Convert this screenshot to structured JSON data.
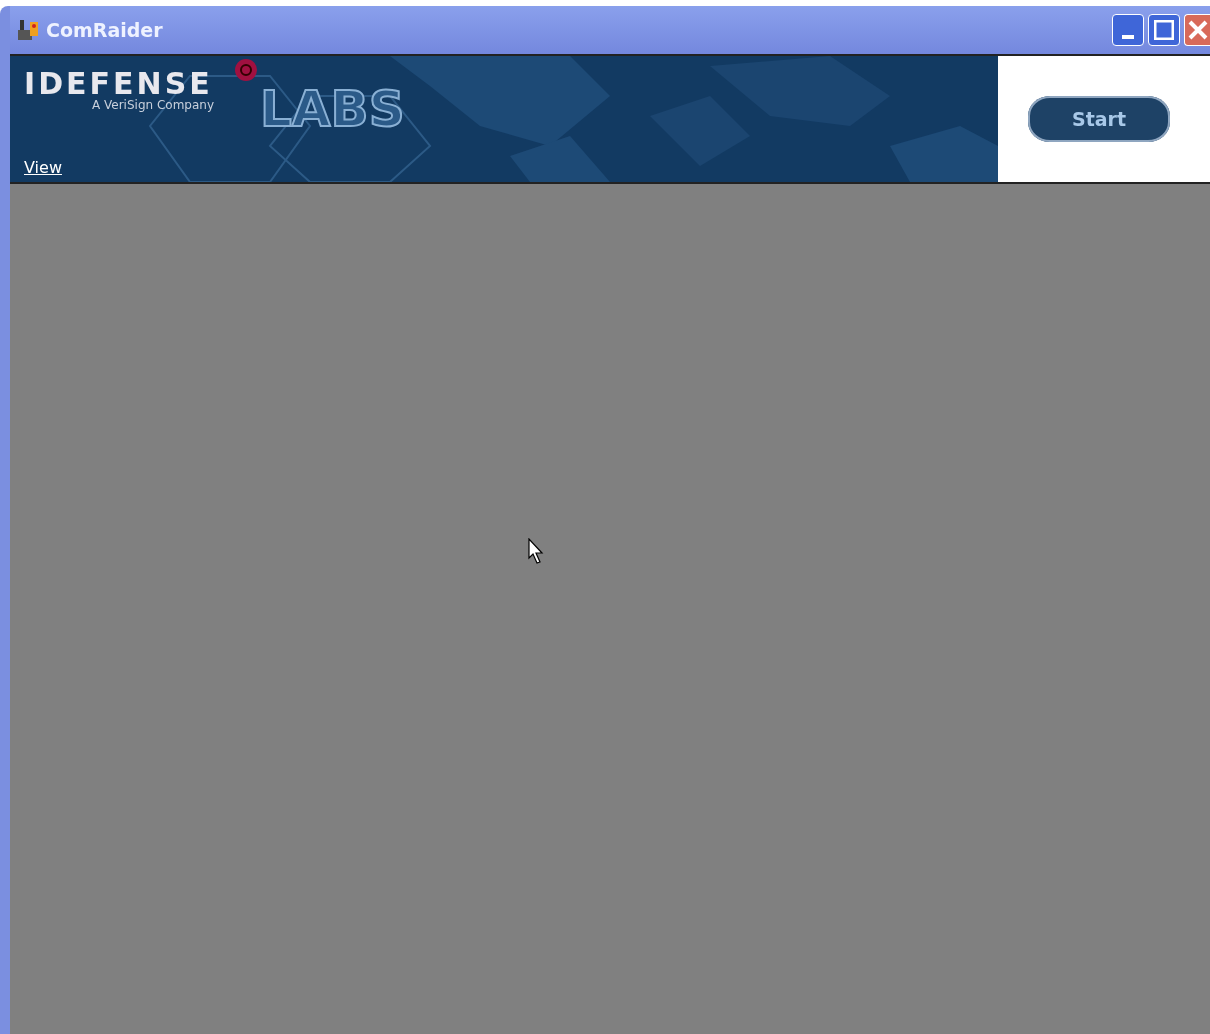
{
  "window": {
    "title": "ComRaider"
  },
  "banner": {
    "logo": "IDEFENSE",
    "tagline": "A VeriSign Company",
    "labs": "LABS",
    "view_link": "View"
  },
  "start_button": "Start"
}
